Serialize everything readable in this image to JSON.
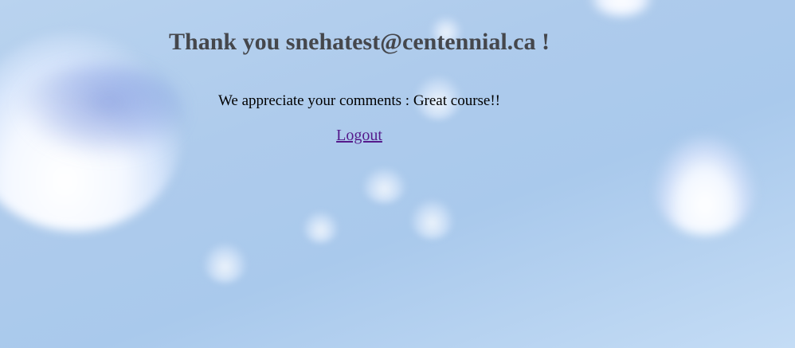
{
  "heading": {
    "prefix": "Thank you ",
    "email": "snehatest@centennial.ca",
    "suffix": " !"
  },
  "message": {
    "label": "We appreciate your comments : ",
    "comment": "Great course!!"
  },
  "logout_link": {
    "label": "Logout"
  },
  "colors": {
    "heading": "#45474c",
    "link_visited": "#551a8b",
    "background": "#aecbec"
  }
}
